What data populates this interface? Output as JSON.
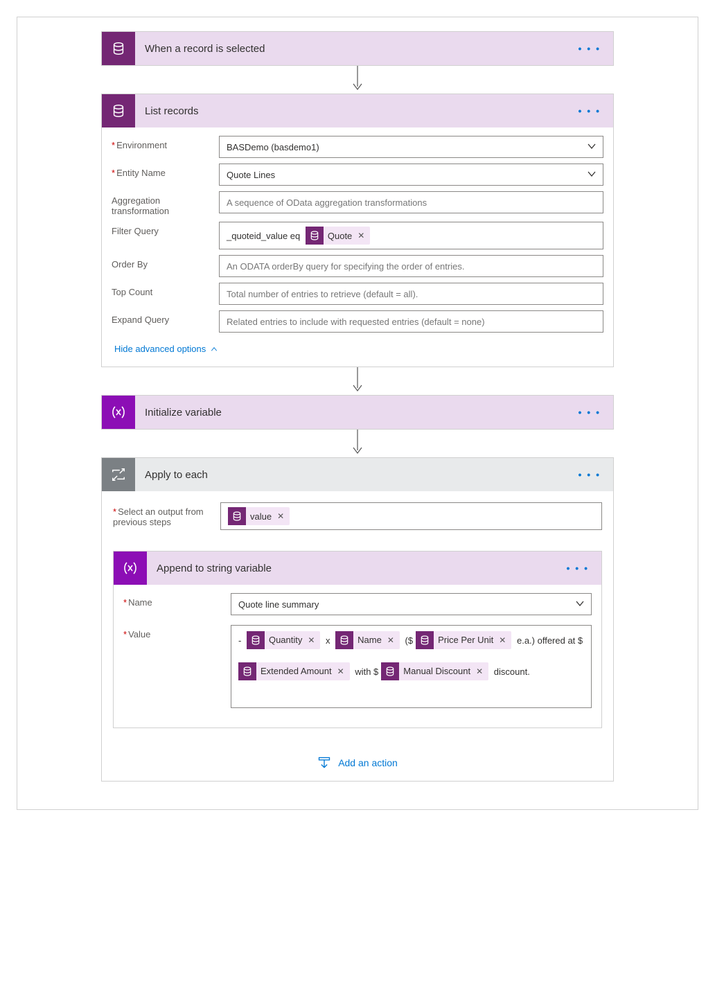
{
  "cards": {
    "trigger": {
      "title": "When a record is selected"
    },
    "list": {
      "title": "List records",
      "fields": {
        "environment": {
          "label": "Environment",
          "value": "BASDemo (basdemo1)"
        },
        "entity": {
          "label": "Entity Name",
          "value": "Quote Lines"
        },
        "agg": {
          "label": "Aggregation transformation",
          "placeholder": "A sequence of OData aggregation transformations"
        },
        "filter": {
          "label": "Filter Query",
          "prefix": "_quoteid_value eq ",
          "token": "Quote"
        },
        "order": {
          "label": "Order By",
          "placeholder": "An ODATA orderBy query for specifying the order of entries."
        },
        "top": {
          "label": "Top Count",
          "placeholder": "Total number of entries to retrieve (default = all)."
        },
        "expand": {
          "label": "Expand Query",
          "placeholder": "Related entries to include with requested entries (default = none)"
        }
      },
      "advlink": "Hide advanced options"
    },
    "init": {
      "title": "Initialize variable"
    },
    "apply": {
      "title": "Apply to each",
      "selectlabel": "Select an output from previous steps",
      "token": "value"
    },
    "append": {
      "title": "Append to string variable",
      "name": {
        "label": "Name",
        "value": "Quote line summary"
      },
      "value": {
        "label": "Value",
        "t_qty": "Quantity",
        "t_name": "Name",
        "t_price": "Price Per Unit",
        "t_ext": "Extended Amount",
        "t_disc": "Manual Discount",
        "s0": "- ",
        "s1": " x ",
        "s2": " ($",
        "s3": " e.a.) offered at $",
        "s4": " with $",
        "s5": " discount."
      }
    },
    "addaction": "Add an action"
  }
}
